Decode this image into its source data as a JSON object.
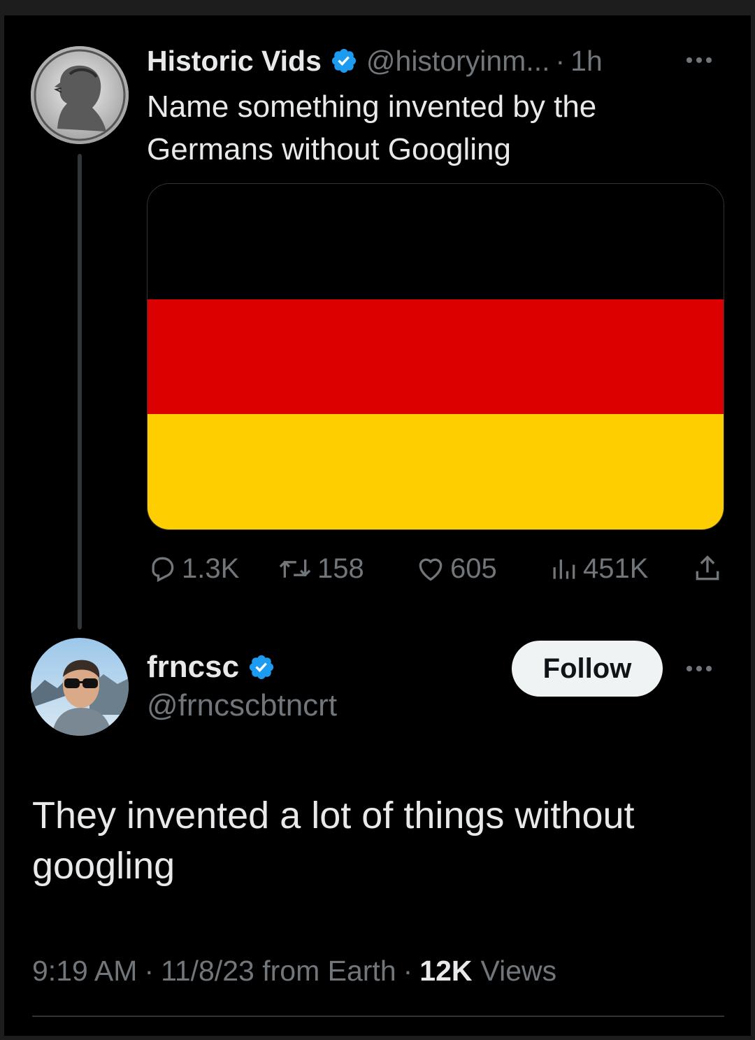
{
  "colors": {
    "background": "#000000",
    "text_primary": "#e7e9ea",
    "text_secondary": "#71767b",
    "verified_blue": "#1d9bf0",
    "flag_black": "#000000",
    "flag_red": "#dd0000",
    "flag_gold": "#ffce00"
  },
  "original_tweet": {
    "display_name": "Historic Vids",
    "handle": "@historyinm...",
    "separator": "·",
    "time_ago": "1h",
    "text": "Name something invented by the Germans without Googling",
    "avatar_icon": "bust-portrait-avatar",
    "media_icon": "german-flag",
    "actions": {
      "replies": "1.3K",
      "reposts": "158",
      "likes": "605",
      "views": "451K"
    }
  },
  "reply_tweet": {
    "display_name": "frncsc",
    "handle": "@frncscbtncrt",
    "follow_label": "Follow",
    "text": "They invented a lot of things without googling",
    "time": "9:19 AM",
    "date_source": "11/8/23 from Earth",
    "views_count": "12K",
    "views_label": "Views",
    "separator": "·"
  }
}
